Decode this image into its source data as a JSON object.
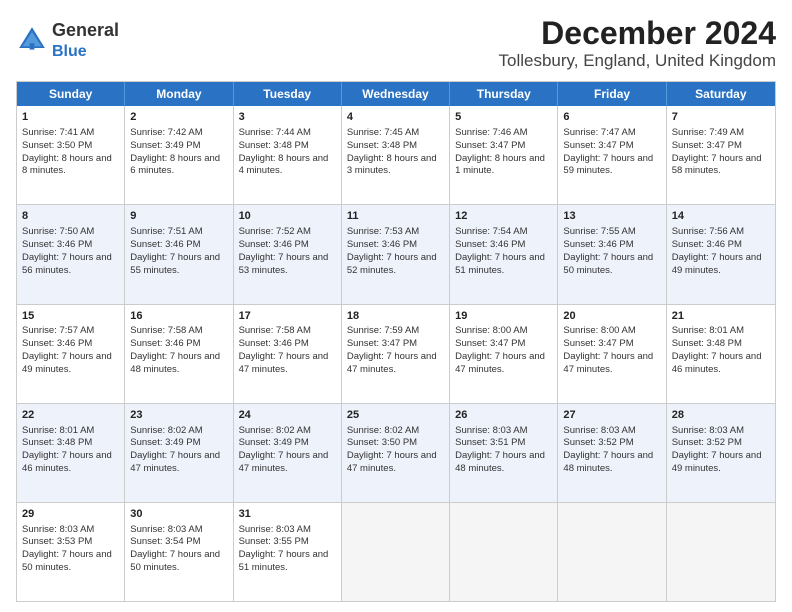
{
  "header": {
    "logo": {
      "line1": "General",
      "line2": "Blue"
    },
    "title": "December 2024",
    "subtitle": "Tollesbury, England, United Kingdom"
  },
  "calendar": {
    "days": [
      "Sunday",
      "Monday",
      "Tuesday",
      "Wednesday",
      "Thursday",
      "Friday",
      "Saturday"
    ],
    "rows": [
      [
        {
          "day": "1",
          "sunrise": "Sunrise: 7:41 AM",
          "sunset": "Sunset: 3:50 PM",
          "daylight": "Daylight: 8 hours and 8 minutes."
        },
        {
          "day": "2",
          "sunrise": "Sunrise: 7:42 AM",
          "sunset": "Sunset: 3:49 PM",
          "daylight": "Daylight: 8 hours and 6 minutes."
        },
        {
          "day": "3",
          "sunrise": "Sunrise: 7:44 AM",
          "sunset": "Sunset: 3:48 PM",
          "daylight": "Daylight: 8 hours and 4 minutes."
        },
        {
          "day": "4",
          "sunrise": "Sunrise: 7:45 AM",
          "sunset": "Sunset: 3:48 PM",
          "daylight": "Daylight: 8 hours and 3 minutes."
        },
        {
          "day": "5",
          "sunrise": "Sunrise: 7:46 AM",
          "sunset": "Sunset: 3:47 PM",
          "daylight": "Daylight: 8 hours and 1 minute."
        },
        {
          "day": "6",
          "sunrise": "Sunrise: 7:47 AM",
          "sunset": "Sunset: 3:47 PM",
          "daylight": "Daylight: 7 hours and 59 minutes."
        },
        {
          "day": "7",
          "sunrise": "Sunrise: 7:49 AM",
          "sunset": "Sunset: 3:47 PM",
          "daylight": "Daylight: 7 hours and 58 minutes."
        }
      ],
      [
        {
          "day": "8",
          "sunrise": "Sunrise: 7:50 AM",
          "sunset": "Sunset: 3:46 PM",
          "daylight": "Daylight: 7 hours and 56 minutes."
        },
        {
          "day": "9",
          "sunrise": "Sunrise: 7:51 AM",
          "sunset": "Sunset: 3:46 PM",
          "daylight": "Daylight: 7 hours and 55 minutes."
        },
        {
          "day": "10",
          "sunrise": "Sunrise: 7:52 AM",
          "sunset": "Sunset: 3:46 PM",
          "daylight": "Daylight: 7 hours and 53 minutes."
        },
        {
          "day": "11",
          "sunrise": "Sunrise: 7:53 AM",
          "sunset": "Sunset: 3:46 PM",
          "daylight": "Daylight: 7 hours and 52 minutes."
        },
        {
          "day": "12",
          "sunrise": "Sunrise: 7:54 AM",
          "sunset": "Sunset: 3:46 PM",
          "daylight": "Daylight: 7 hours and 51 minutes."
        },
        {
          "day": "13",
          "sunrise": "Sunrise: 7:55 AM",
          "sunset": "Sunset: 3:46 PM",
          "daylight": "Daylight: 7 hours and 50 minutes."
        },
        {
          "day": "14",
          "sunrise": "Sunrise: 7:56 AM",
          "sunset": "Sunset: 3:46 PM",
          "daylight": "Daylight: 7 hours and 49 minutes."
        }
      ],
      [
        {
          "day": "15",
          "sunrise": "Sunrise: 7:57 AM",
          "sunset": "Sunset: 3:46 PM",
          "daylight": "Daylight: 7 hours and 49 minutes."
        },
        {
          "day": "16",
          "sunrise": "Sunrise: 7:58 AM",
          "sunset": "Sunset: 3:46 PM",
          "daylight": "Daylight: 7 hours and 48 minutes."
        },
        {
          "day": "17",
          "sunrise": "Sunrise: 7:58 AM",
          "sunset": "Sunset: 3:46 PM",
          "daylight": "Daylight: 7 hours and 47 minutes."
        },
        {
          "day": "18",
          "sunrise": "Sunrise: 7:59 AM",
          "sunset": "Sunset: 3:47 PM",
          "daylight": "Daylight: 7 hours and 47 minutes."
        },
        {
          "day": "19",
          "sunrise": "Sunrise: 8:00 AM",
          "sunset": "Sunset: 3:47 PM",
          "daylight": "Daylight: 7 hours and 47 minutes."
        },
        {
          "day": "20",
          "sunrise": "Sunrise: 8:00 AM",
          "sunset": "Sunset: 3:47 PM",
          "daylight": "Daylight: 7 hours and 47 minutes."
        },
        {
          "day": "21",
          "sunrise": "Sunrise: 8:01 AM",
          "sunset": "Sunset: 3:48 PM",
          "daylight": "Daylight: 7 hours and 46 minutes."
        }
      ],
      [
        {
          "day": "22",
          "sunrise": "Sunrise: 8:01 AM",
          "sunset": "Sunset: 3:48 PM",
          "daylight": "Daylight: 7 hours and 46 minutes."
        },
        {
          "day": "23",
          "sunrise": "Sunrise: 8:02 AM",
          "sunset": "Sunset: 3:49 PM",
          "daylight": "Daylight: 7 hours and 47 minutes."
        },
        {
          "day": "24",
          "sunrise": "Sunrise: 8:02 AM",
          "sunset": "Sunset: 3:49 PM",
          "daylight": "Daylight: 7 hours and 47 minutes."
        },
        {
          "day": "25",
          "sunrise": "Sunrise: 8:02 AM",
          "sunset": "Sunset: 3:50 PM",
          "daylight": "Daylight: 7 hours and 47 minutes."
        },
        {
          "day": "26",
          "sunrise": "Sunrise: 8:03 AM",
          "sunset": "Sunset: 3:51 PM",
          "daylight": "Daylight: 7 hours and 48 minutes."
        },
        {
          "day": "27",
          "sunrise": "Sunrise: 8:03 AM",
          "sunset": "Sunset: 3:52 PM",
          "daylight": "Daylight: 7 hours and 48 minutes."
        },
        {
          "day": "28",
          "sunrise": "Sunrise: 8:03 AM",
          "sunset": "Sunset: 3:52 PM",
          "daylight": "Daylight: 7 hours and 49 minutes."
        }
      ],
      [
        {
          "day": "29",
          "sunrise": "Sunrise: 8:03 AM",
          "sunset": "Sunset: 3:53 PM",
          "daylight": "Daylight: 7 hours and 50 minutes."
        },
        {
          "day": "30",
          "sunrise": "Sunrise: 8:03 AM",
          "sunset": "Sunset: 3:54 PM",
          "daylight": "Daylight: 7 hours and 50 minutes."
        },
        {
          "day": "31",
          "sunrise": "Sunrise: 8:03 AM",
          "sunset": "Sunset: 3:55 PM",
          "daylight": "Daylight: 7 hours and 51 minutes."
        },
        null,
        null,
        null,
        null
      ]
    ]
  }
}
